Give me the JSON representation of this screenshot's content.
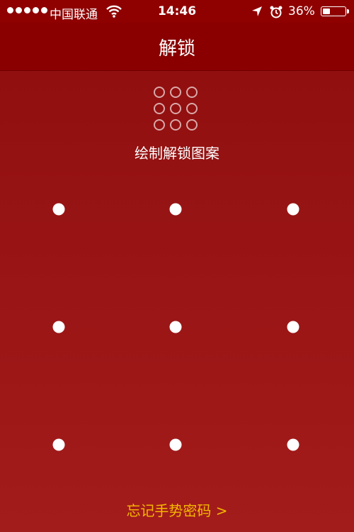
{
  "status_bar": {
    "carrier": "中国联通",
    "time": "14:46",
    "battery_percent": "36%",
    "battery_level": 0.36,
    "icons": [
      "signal-dots-icon",
      "wifi-icon",
      "location-arrow-icon",
      "alarm-clock-icon",
      "battery-icon"
    ]
  },
  "nav": {
    "title": "解锁"
  },
  "unlock": {
    "hint": "绘制解锁图案",
    "forgot_label": "忘记手势密码 >"
  },
  "colors": {
    "background_top": "#8e0c0c",
    "background_bottom": "#a31c1c",
    "nav_bar": "#8a0000",
    "forgot_link": "#f5b800",
    "dot": "#ffffff"
  }
}
